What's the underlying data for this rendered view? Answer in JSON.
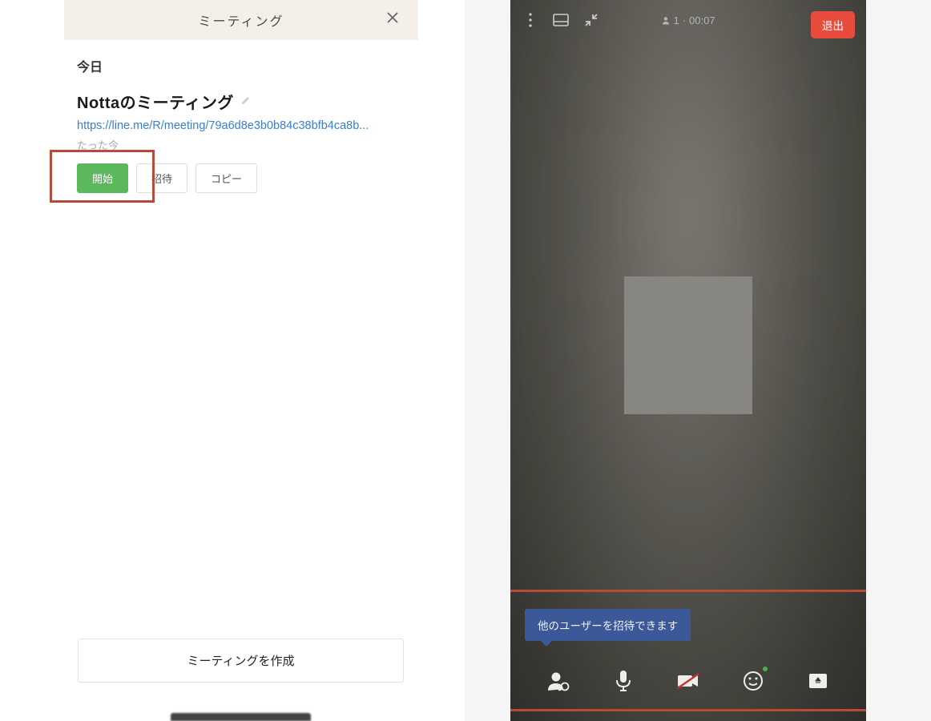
{
  "left": {
    "header_title": "ミーティング",
    "date_label": "今日",
    "meeting_title": "Nottaのミーティング",
    "meeting_link": "https://line.me/R/meeting/79a6d8e3b0b84c38bfb4ca8b...",
    "timestamp": "たった今",
    "buttons": {
      "start": "開始",
      "invite": "招待",
      "copy": "コピー"
    },
    "create_button": "ミーティングを作成"
  },
  "right": {
    "participants": "1",
    "duration": "00:07",
    "exit_label": "退出",
    "tooltip": "他のユーザーを招待できます"
  }
}
